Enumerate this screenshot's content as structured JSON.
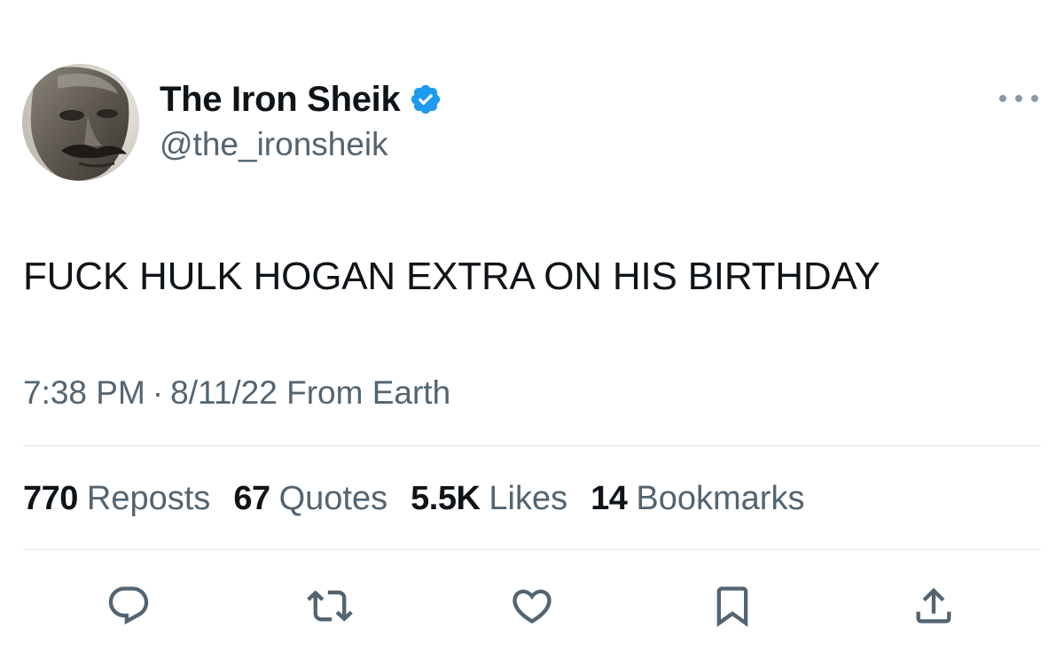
{
  "user": {
    "display_name": "The Iron Sheik",
    "handle": "@the_ironsheik",
    "verified": true,
    "verified_color": "#1d9bf0",
    "avatar_icon": "profile-photo"
  },
  "tweet": {
    "text": "FUCK HULK HOGAN EXTRA ON HIS BIRTHDAY",
    "time": "7:38 PM",
    "separator": "·",
    "date": "8/11/22",
    "source": "From Earth"
  },
  "stats": {
    "reposts": {
      "count": "770",
      "label": "Reposts"
    },
    "quotes": {
      "count": "67",
      "label": "Quotes"
    },
    "likes": {
      "count": "5.5K",
      "label": "Likes"
    },
    "bookmarks": {
      "count": "14",
      "label": "Bookmarks"
    }
  },
  "actions": {
    "reply_icon": "reply-icon",
    "repost_icon": "repost-icon",
    "like_icon": "heart-icon",
    "bookmark_icon": "bookmark-icon",
    "share_icon": "share-icon"
  },
  "colors": {
    "text_primary": "#0f1419",
    "text_secondary": "#536471",
    "divider": "#e1e6ea"
  }
}
